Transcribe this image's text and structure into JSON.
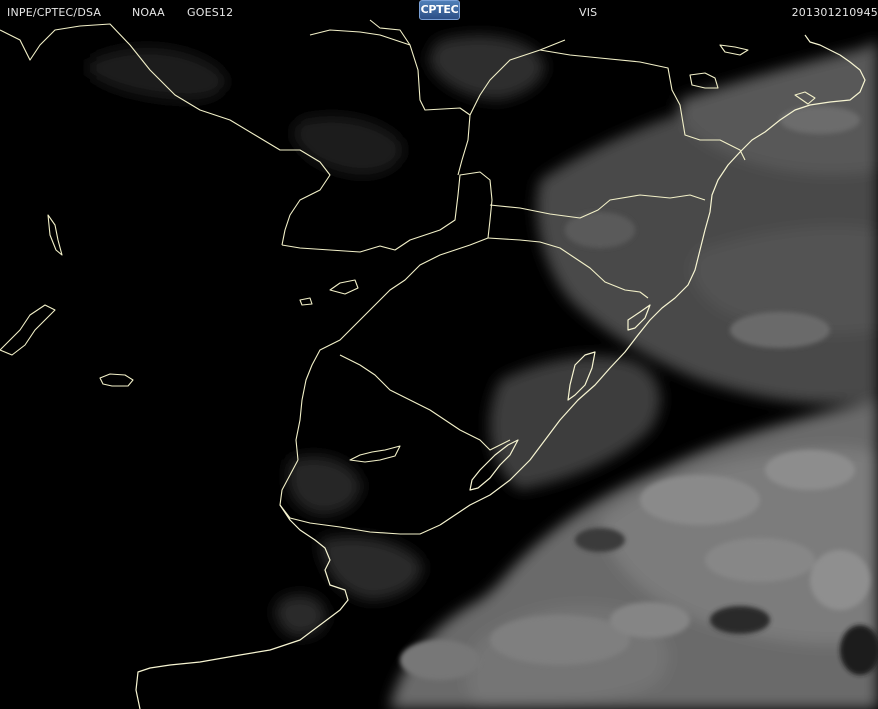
{
  "header": {
    "agency": "INPE/CPTEC/DSA",
    "provider": "NOAA",
    "satellite": "GOES12",
    "logo_text": "CPTEC",
    "channel": "VIS",
    "timestamp": "201301210945"
  },
  "colors": {
    "background": "#000000",
    "header_text": "#e6e6e6",
    "boundaries": "#f2f0c8",
    "logo_blue": "#3a64a0"
  },
  "map": {
    "type": "satellite visible-channel image",
    "region": "Southern Brazil, Uruguay, northeast Argentina and adjacent South Atlantic",
    "overlay": "country and state boundary lines"
  }
}
